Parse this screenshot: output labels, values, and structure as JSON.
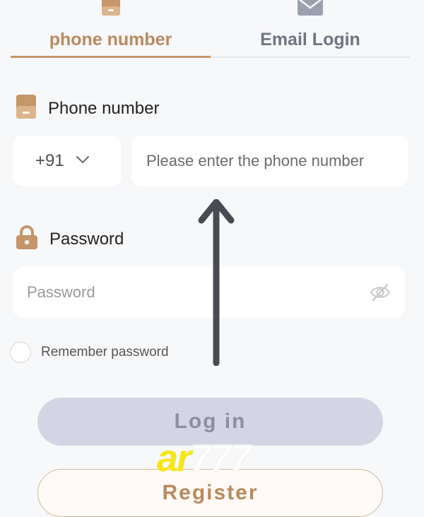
{
  "tabs": {
    "phone": {
      "label": "phone number",
      "icon": "phone-icon",
      "active": true
    },
    "email": {
      "label": "Email Login",
      "icon": "mail-icon",
      "active": false
    }
  },
  "phone_section": {
    "label": "Phone number",
    "icon": "phone-icon",
    "country_code": "+91",
    "placeholder": "Please enter the phone number",
    "value": ""
  },
  "password_section": {
    "label": "Password",
    "icon": "lock-icon",
    "placeholder": "Password",
    "value": "",
    "toggle_icon": "eye-off-icon"
  },
  "remember": {
    "label": "Remember password",
    "checked": false
  },
  "buttons": {
    "login": "Log in",
    "register": "Register"
  },
  "overlay": {
    "arrow_icon": "up-arrow-icon",
    "watermark_part1": "ar",
    "watermark_part2": "777"
  },
  "colors": {
    "accent": "#c4966a",
    "accent_text": "#b98a5e",
    "login_bg": "#d4d5e4",
    "background": "#f7f8fa",
    "watermark_yellow": "#f6e616"
  }
}
